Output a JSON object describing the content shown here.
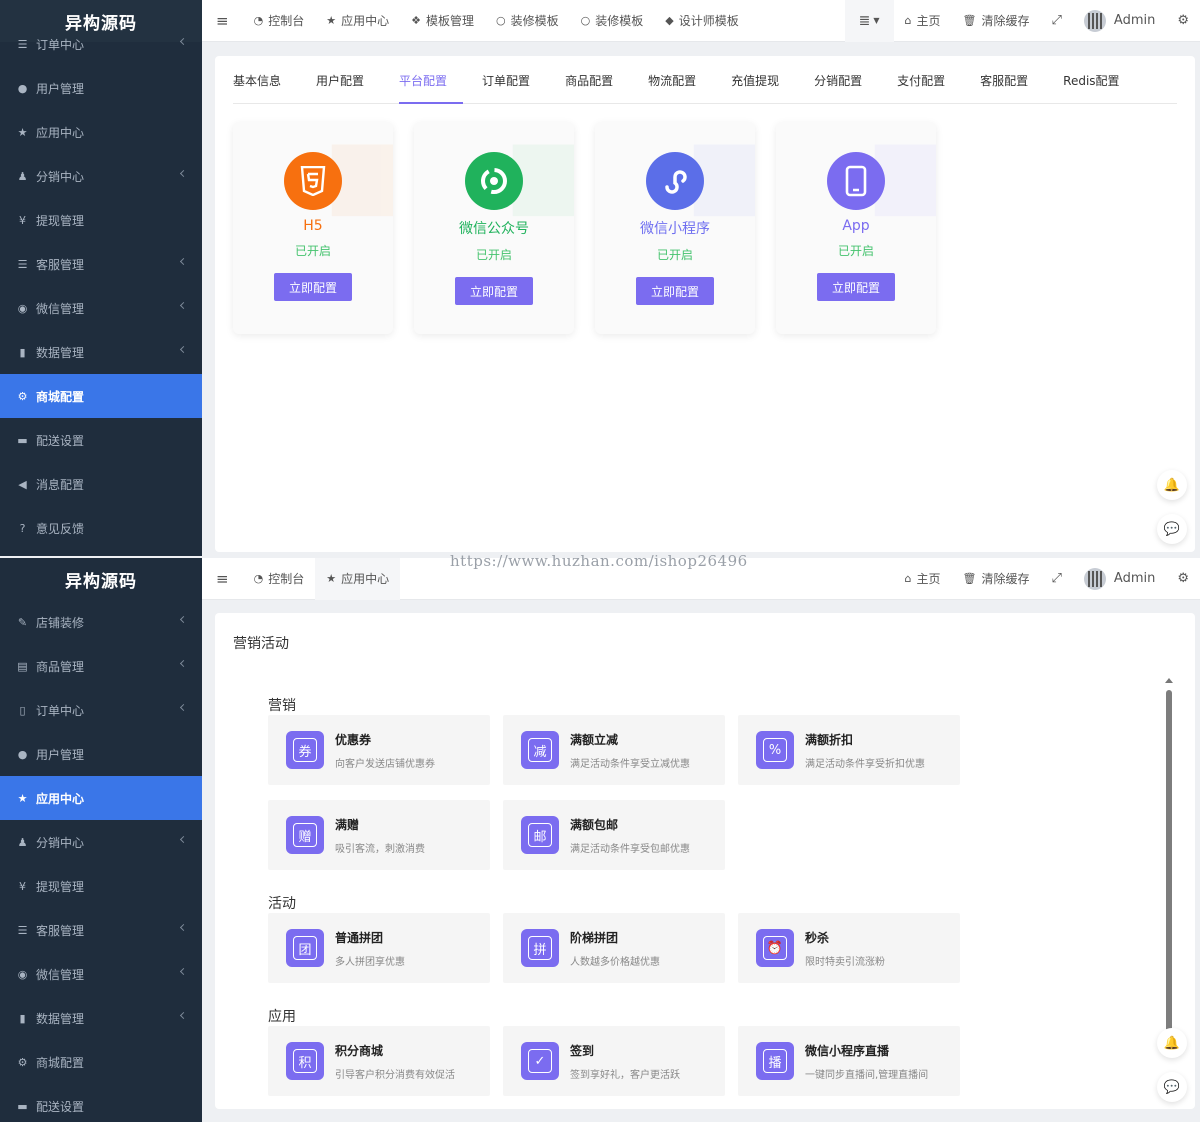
{
  "brand": "异构源码",
  "watermark": "https://www.huzhan.com/ishop26496",
  "colors": {
    "accent": "#7b6cf0",
    "sidebar_bg": "#1f2d3d",
    "active_menu": "#3a76e8",
    "status_green": "#45c36e"
  },
  "screen1": {
    "sidebar": [
      {
        "label": "订单中心",
        "icon": "list-icon",
        "arrow": true
      },
      {
        "label": "用户管理",
        "icon": "user-icon",
        "arrow": false
      },
      {
        "label": "应用中心",
        "icon": "star-icon",
        "arrow": false
      },
      {
        "label": "分销中心",
        "icon": "users-icon",
        "arrow": true
      },
      {
        "label": "提现管理",
        "icon": "yen-icon",
        "arrow": false
      },
      {
        "label": "客服管理",
        "icon": "list-icon",
        "arrow": true
      },
      {
        "label": "微信管理",
        "icon": "wechat-icon",
        "arrow": true
      },
      {
        "label": "数据管理",
        "icon": "chart-icon",
        "arrow": true
      },
      {
        "label": "商城配置",
        "icon": "cogs-icon",
        "arrow": false,
        "active": true
      },
      {
        "label": "配送设置",
        "icon": "car-icon",
        "arrow": false
      },
      {
        "label": "消息配置",
        "icon": "bullhorn-icon",
        "arrow": false
      },
      {
        "label": "意见反馈",
        "icon": "question-icon",
        "arrow": false
      }
    ],
    "topbar": [
      {
        "label": "控制台",
        "icon": "dashboard-icon"
      },
      {
        "label": "应用中心",
        "icon": "star-icon"
      },
      {
        "label": "模板管理",
        "icon": "cubes-icon"
      },
      {
        "label": "装修模板",
        "icon": "circle-icon"
      },
      {
        "label": "装修模板",
        "icon": "circle-icon"
      },
      {
        "label": "设计师模板",
        "icon": "cube-icon"
      }
    ],
    "tabs": [
      "基本信息",
      "用户配置",
      "平台配置",
      "订单配置",
      "商品配置",
      "物流配置",
      "充值提现",
      "分销配置",
      "支付配置",
      "客服配置",
      "Redis配置"
    ],
    "active_tab": 2,
    "platforms": [
      {
        "name": "H5",
        "status": "已开启",
        "button": "立即配置",
        "icon": "html5-icon",
        "color": "#f7700f",
        "name_color": "#f7700f"
      },
      {
        "name": "微信公众号",
        "status": "已开启",
        "button": "立即配置",
        "icon": "wechat-official-icon",
        "color": "#20b25c",
        "name_color": "#20b25c"
      },
      {
        "name": "微信小程序",
        "status": "已开启",
        "button": "立即配置",
        "icon": "mini-program-icon",
        "color": "#5b6ee8",
        "name_color": "#6f6ff0"
      },
      {
        "name": "App",
        "status": "已开启",
        "button": "立即配置",
        "icon": "mobile-icon",
        "color": "#7b6cf0",
        "name_color": "#7b6cf0"
      }
    ]
  },
  "screen2": {
    "sidebar": [
      {
        "label": "店铺装修",
        "icon": "brush-icon",
        "arrow": true
      },
      {
        "label": "商品管理",
        "icon": "archive-icon",
        "arrow": true
      },
      {
        "label": "订单中心",
        "icon": "file-icon",
        "arrow": true
      },
      {
        "label": "用户管理",
        "icon": "user-icon",
        "arrow": false
      },
      {
        "label": "应用中心",
        "icon": "star-icon",
        "arrow": false,
        "active": true
      },
      {
        "label": "分销中心",
        "icon": "users-icon",
        "arrow": true
      },
      {
        "label": "提现管理",
        "icon": "yen-icon",
        "arrow": false
      },
      {
        "label": "客服管理",
        "icon": "list-icon",
        "arrow": true
      },
      {
        "label": "微信管理",
        "icon": "wechat-icon",
        "arrow": true
      },
      {
        "label": "数据管理",
        "icon": "chart-icon",
        "arrow": true
      },
      {
        "label": "商城配置",
        "icon": "cogs-icon",
        "arrow": false
      },
      {
        "label": "配送设置",
        "icon": "car-icon",
        "arrow": false
      }
    ],
    "topbar": [
      {
        "label": "控制台",
        "icon": "dashboard-icon"
      },
      {
        "label": "应用中心",
        "icon": "star-icon"
      }
    ],
    "title": "营销活动",
    "sections": [
      {
        "name": "营销",
        "items": [
          {
            "title": "优惠券",
            "desc": "向客户发送店铺优惠券",
            "glyph": "券"
          },
          {
            "title": "满额立减",
            "desc": "满足活动条件享受立减优惠",
            "glyph": "减"
          },
          {
            "title": "满额折扣",
            "desc": "满足活动条件享受折扣优惠",
            "glyph": "%"
          },
          {
            "title": "满赠",
            "desc": "吸引客流，刺激消费",
            "glyph": "赠"
          },
          {
            "title": "满额包邮",
            "desc": "满足活动条件享受包邮优惠",
            "glyph": "邮"
          }
        ]
      },
      {
        "name": "活动",
        "items": [
          {
            "title": "普通拼团",
            "desc": "多人拼团享优惠",
            "glyph": "团"
          },
          {
            "title": "阶梯拼团",
            "desc": "人数越多价格越优惠",
            "glyph": "拼"
          },
          {
            "title": "秒杀",
            "desc": "限时特卖引流涨粉",
            "glyph": "⏰"
          }
        ]
      },
      {
        "name": "应用",
        "items": [
          {
            "title": "积分商城",
            "desc": "引导客户积分消费有效促活",
            "glyph": "积"
          },
          {
            "title": "签到",
            "desc": "签到享好礼，客户更活跃",
            "glyph": "✓"
          },
          {
            "title": "微信小程序直播",
            "desc": "一键同步直播间,管理直播间",
            "glyph": "播"
          }
        ]
      }
    ]
  },
  "common": {
    "home": "主页",
    "clear_cache": "清除缓存",
    "admin": "Admin"
  }
}
